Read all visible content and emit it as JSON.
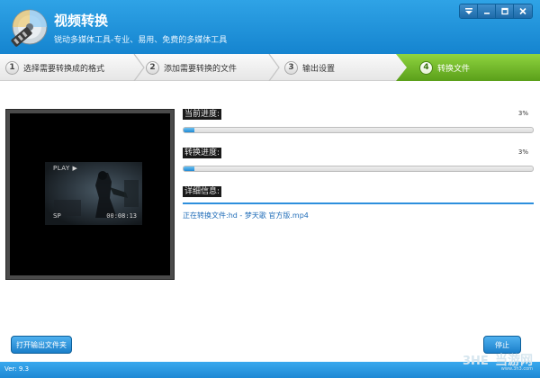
{
  "app": {
    "title": "视频转换",
    "subtitle": "锐动多媒体工具-专业、易用、免费的多媒体工具"
  },
  "window_controls": {
    "icons": [
      "dropdown-menu-icon",
      "minimize-icon",
      "maximize-icon",
      "close-icon"
    ]
  },
  "steps": [
    {
      "num": "1",
      "label": "选择需要转换成的格式",
      "active": false
    },
    {
      "num": "2",
      "label": "添加需要转换的文件",
      "active": false
    },
    {
      "num": "3",
      "label": "输出设置",
      "active": false
    },
    {
      "num": "4",
      "label": "转换文件",
      "active": true
    }
  ],
  "preview": {
    "play_label": "PLAY ▶",
    "sp_label": "SP",
    "timecode": "00:08:13"
  },
  "progress": {
    "current_label": "当前进度:",
    "current_value": 0.03,
    "current_text": "3%",
    "total_label": "转换进度:",
    "total_value": 0.03,
    "total_text": "3%"
  },
  "details": {
    "label": "详细信息:",
    "message": "正在转换文件:hd - 梦天歌 官方版.mp4"
  },
  "buttons": {
    "open_output": "打开输出文件夹",
    "stop": "停止"
  },
  "status": {
    "version": "Ver: 9.3"
  },
  "watermark": {
    "text": "当游网",
    "site": "www.3h3.com"
  },
  "colors": {
    "title_bar": "#1f8fd9",
    "active_step": "#6fb52a",
    "progress_fill": "#2b8fdc",
    "button": "#2a90d8"
  }
}
